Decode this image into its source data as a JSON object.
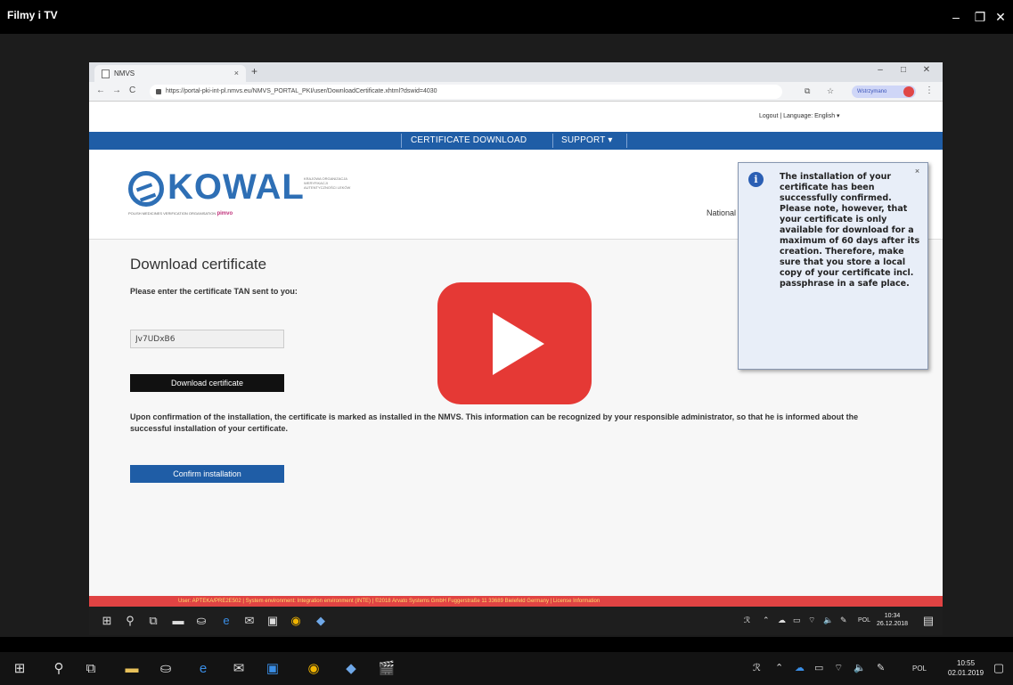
{
  "outer_window": {
    "title": "Filmy i TV",
    "minimize": "–",
    "maximize": "❐",
    "close": "✕"
  },
  "browser": {
    "tab_title": "NMVS",
    "tab_close": "×",
    "new_tab": "+",
    "window_min": "–",
    "window_max": "□",
    "window_close": "✕",
    "back": "←",
    "forward": "→",
    "reload": "C",
    "url": "https://portal-pki-int-pl.nmvs.eu/NMVS_PORTAL_PKI/user/DownloadCertificate.xhtml?dswid=4030",
    "ext1": "⧉",
    "star": "☆",
    "profile": "Wstrzymano",
    "kebab": "⋮"
  },
  "page": {
    "top_links": "Logout | Language: English ▾",
    "nav": [
      "CERTIFICATE DOWNLOAD",
      "SUPPORT ▾"
    ],
    "logo_text": "KOWAL",
    "logo_small": "KRAJOWA ORGANIZACJA WERYFIKACJI AUTENTYCZNOŚCI LEKÓW",
    "logo_tagline": "POLISH MEDICINES VERIFICATION ORGANISATION",
    "logo_brand": "pimvo",
    "national": "National",
    "heading": "Download certificate",
    "tan_label": "Please enter the certificate TAN sent to you:",
    "tan_value": "Jv7UDxB6",
    "download_button": "Download certificate",
    "info_text": "Upon confirmation of the installation, the certificate is marked as installed in the NMVS. This information can be recognized by your responsible administrator, so that he is informed about the successful installation of your certificate.",
    "confirm_button": "Confirm installation",
    "footer": "User: APTEKA/PRE2E502 | System environment: Integration environment (INTE) | ©2018 Arvato Systems GmbH Fuggerstraße 11 33689 Bielefeld Germany | License Information"
  },
  "bubble": {
    "icon": "i",
    "close": "×",
    "message": "The installation of your certificate has been successfully confirmed. Please note, however, that your certificate is only available for download for a maximum of 60 days after its creation. Therefore, make sure that you store a local copy of your certificate incl. passphrase in a safe place."
  },
  "inner_taskbar": {
    "lang": "POL",
    "time": "10:34",
    "date": "26.12.2018"
  },
  "taskbar": {
    "lang": "POL",
    "time": "10:55",
    "date": "02.01.2019"
  },
  "colors": {
    "nav_blue": "#1f5da6",
    "logo_blue": "#2e6fb5",
    "play_red": "#e53935",
    "footer_red": "#e04343"
  }
}
